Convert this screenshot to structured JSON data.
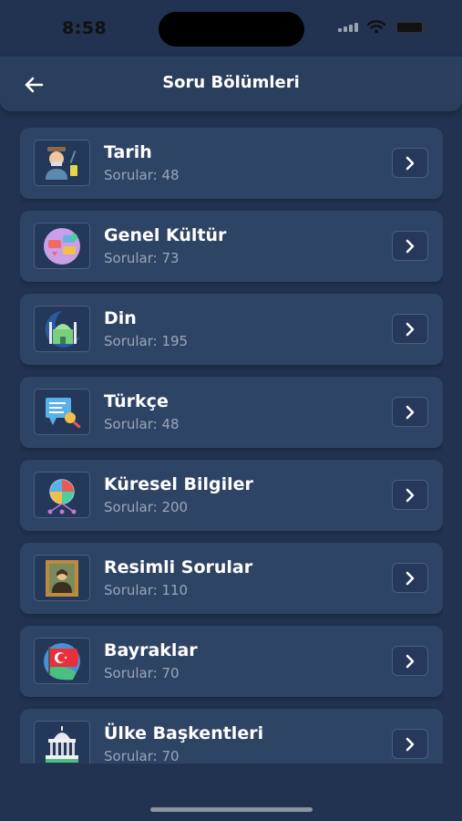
{
  "status": {
    "time": "8:58"
  },
  "header": {
    "title": "Soru Bölümleri"
  },
  "categories": [
    {
      "title": "Tarih",
      "subtitle": "Sorular: 48",
      "icon": "history-person-icon"
    },
    {
      "title": "Genel Kültür",
      "subtitle": "Sorular: 73",
      "icon": "chat-bubbles-icon"
    },
    {
      "title": "Din",
      "subtitle": "Sorular: 195",
      "icon": "mosque-crescent-icon"
    },
    {
      "title": "Türkçe",
      "subtitle": "Sorular: 48",
      "icon": "document-magnifier-icon"
    },
    {
      "title": "Küresel Bilgiler",
      "subtitle": "Sorular: 200",
      "icon": "global-network-icon"
    },
    {
      "title": "Resimli Sorular",
      "subtitle": "Sorular: 110",
      "icon": "framed-painting-icon"
    },
    {
      "title": "Bayraklar",
      "subtitle": "Sorular: 70",
      "icon": "turkish-flag-icon"
    },
    {
      "title": "Ülke Başkentleri",
      "subtitle": "Sorular: 70",
      "icon": "capitol-building-icon"
    }
  ]
}
